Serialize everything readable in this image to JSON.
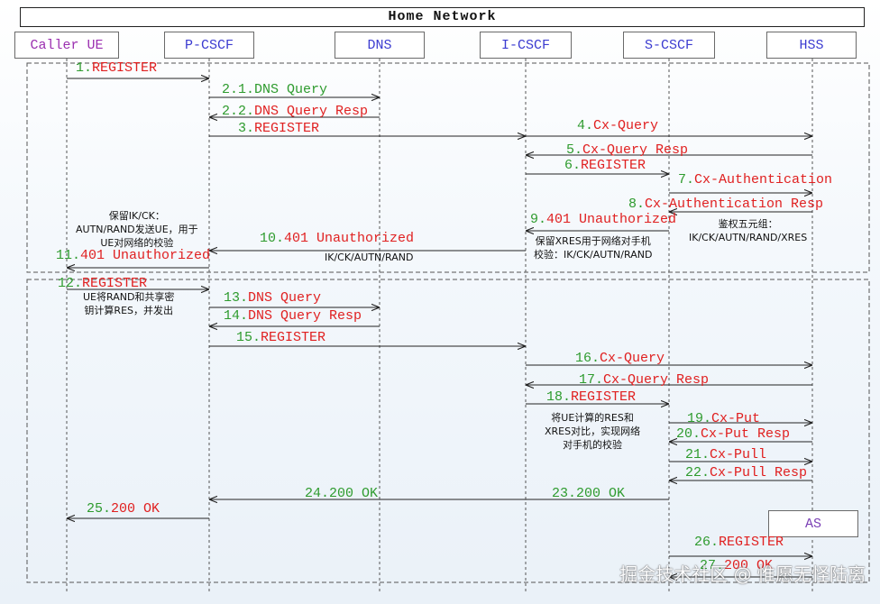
{
  "title": "Home Network",
  "actors": [
    {
      "label": "Caller UE",
      "color": "#9b2fb0"
    },
    {
      "label": "P-CSCF",
      "color": "#3b3bd0"
    },
    {
      "label": "DNS",
      "color": "#3b3bd0"
    },
    {
      "label": "I-CSCF",
      "color": "#3b3bd0"
    },
    {
      "label": "S-CSCF",
      "color": "#3b3bd0"
    },
    {
      "label": "HSS",
      "color": "#3b3bd0"
    }
  ],
  "as_label": "AS",
  "messages": [
    {
      "num": "1.",
      "text": "REGISTER"
    },
    {
      "num": "2.1.",
      "text": "DNS Query"
    },
    {
      "num": "2.2.",
      "text": "DNS Query Resp"
    },
    {
      "num": "3.",
      "text": "REGISTER"
    },
    {
      "num": "4.",
      "text": "Cx-Query"
    },
    {
      "num": "5.",
      "text": "Cx-Query Resp"
    },
    {
      "num": "6.",
      "text": "REGISTER"
    },
    {
      "num": "7.",
      "text": "Cx-Authentication"
    },
    {
      "num": "8.",
      "text": "Cx-Authentication Resp"
    },
    {
      "num": "9.",
      "text": "401 Unauthorized"
    },
    {
      "num": "10.",
      "text": "401 Unauthorized"
    },
    {
      "num": "11.",
      "text": "401 Unauthorized"
    },
    {
      "num": "12.",
      "text": "REGISTER"
    },
    {
      "num": "13.",
      "text": "DNS Query"
    },
    {
      "num": "14.",
      "text": "DNS Query Resp"
    },
    {
      "num": "15.",
      "text": "REGISTER"
    },
    {
      "num": "16.",
      "text": "Cx-Query"
    },
    {
      "num": "17.",
      "text": "Cx-Query Resp"
    },
    {
      "num": "18.",
      "text": "REGISTER"
    },
    {
      "num": "19.",
      "text": "Cx-Put"
    },
    {
      "num": "20.",
      "text": "Cx-Put Resp"
    },
    {
      "num": "21.",
      "text": "Cx-Pull"
    },
    {
      "num": "22.",
      "text": "Cx-Pull Resp"
    },
    {
      "num": "23.",
      "text": "200 OK"
    },
    {
      "num": "24.",
      "text": "200 OK"
    },
    {
      "num": "25.",
      "text": "200 OK"
    },
    {
      "num": "26.",
      "text": "REGISTER"
    },
    {
      "num": "27.",
      "text": "200 OK"
    }
  ],
  "notes": {
    "ue_keep": [
      "保留IK/CK：",
      "AUTN/RAND发送UE，用于",
      "UE对网络的校验"
    ],
    "ik_ck": "IK/CK/AUTN/RAND",
    "auth_vector": [
      "鉴权五元组：",
      "IK/CK/AUTN/RAND/XRES"
    ],
    "icscf_keep": [
      "保留XRES用于网络对手机",
      "校验：IK/CK/AUTN/RAND"
    ],
    "ue_res": [
      "UE将RAND和共享密",
      "钥计算RES，并发出"
    ],
    "compare": [
      "将UE计算的RES和",
      "XRES对比，实现网络",
      "对手机的校验"
    ]
  },
  "watermark": "掘金技术社区 @ 惟愿无怪陆离"
}
